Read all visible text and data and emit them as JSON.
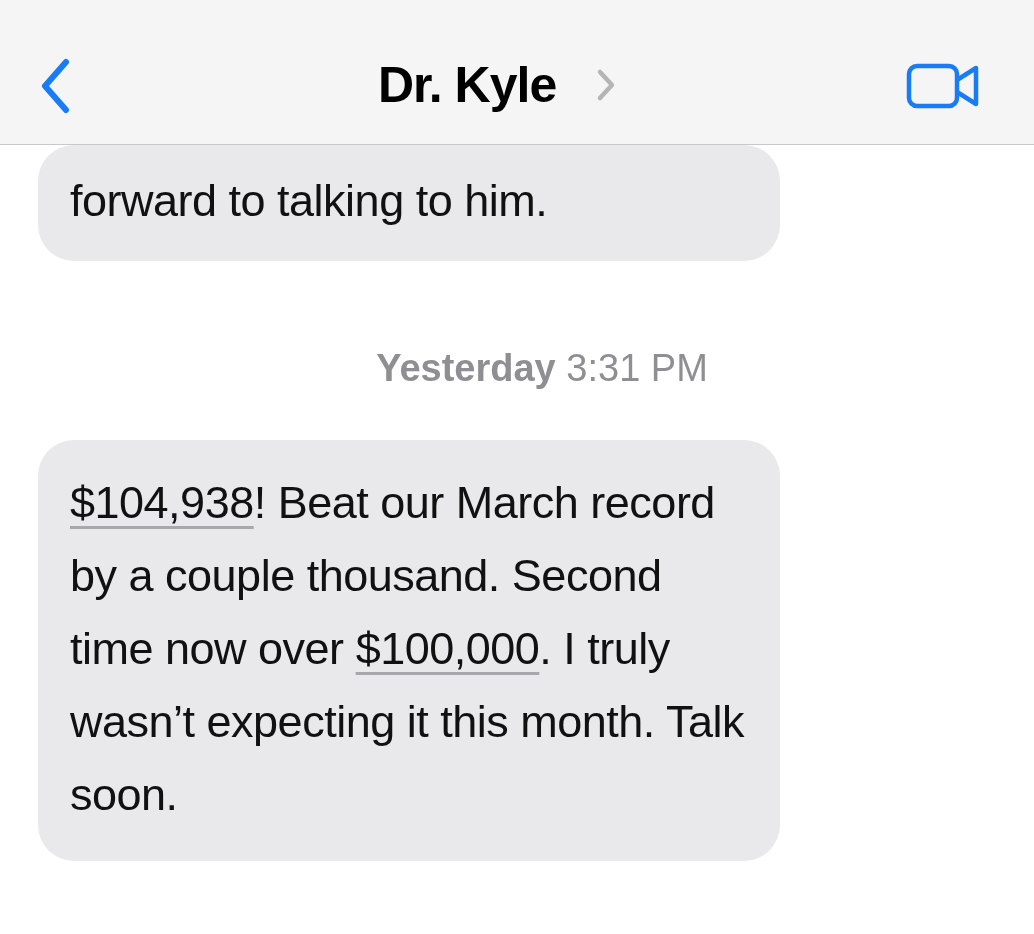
{
  "header": {
    "title": "Dr. Kyle"
  },
  "messages": [
    {
      "kind": "cut",
      "parts": [
        {
          "kind": "text",
          "text": "forward to talking to him."
        }
      ]
    },
    {
      "kind": "timestamp",
      "day": "Yesterday",
      "time": "3:31 PM"
    },
    {
      "kind": "bubble",
      "parts": [
        {
          "kind": "link",
          "text": "$104,938"
        },
        {
          "kind": "text",
          "text": "! Beat our March record by a couple thousand. Second time now over "
        },
        {
          "kind": "link",
          "text": "$100,000"
        },
        {
          "kind": "text",
          "text": ". I truly wasn’t expecting it this month. Talk soon."
        }
      ]
    }
  ]
}
